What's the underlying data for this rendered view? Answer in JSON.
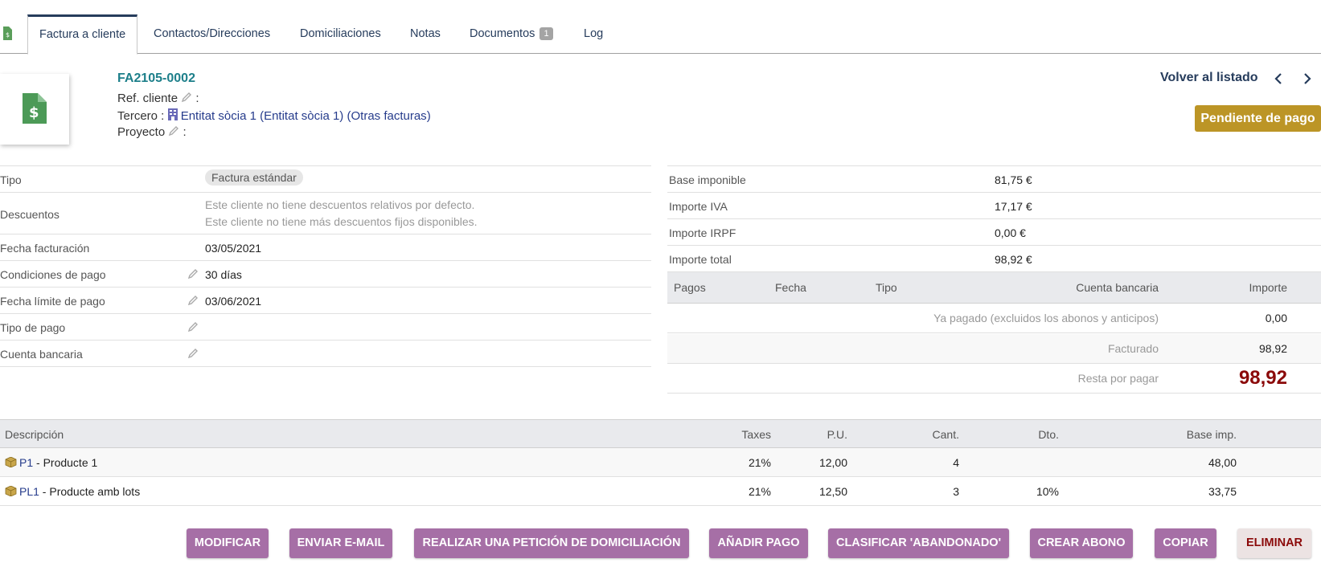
{
  "tabs": [
    {
      "label": "Factura a cliente",
      "active": true
    },
    {
      "label": "Contactos/Direcciones"
    },
    {
      "label": "Domiciliaciones"
    },
    {
      "label": "Notas"
    },
    {
      "label": "Documentos",
      "badge": "1"
    },
    {
      "label": "Log"
    }
  ],
  "header": {
    "ref": "FA2105-0002",
    "ref_cliente_label": "Ref. cliente",
    "tercero_label": "Tercero :",
    "tercero_link": "Entitat sòcia 1 (Entitat sòcia 1)",
    "otras_facturas": "Otras facturas",
    "proyecto_label": "Proyecto",
    "back_label": "Volver al listado",
    "prev_icon": "chevron-left-icon",
    "next_icon": "chevron-right-icon",
    "status": "Pendiente de pago",
    "status_color": "#bc9526"
  },
  "info": {
    "tipo_label": "Tipo",
    "tipo_value": "Factura estándar",
    "descuentos_label": "Descuentos",
    "descuentos_line1": "Este cliente no tiene descuentos relativos por defecto.",
    "descuentos_line2": "Este cliente no tiene más descuentos fijos disponibles.",
    "fecha_fact_label": "Fecha facturación",
    "fecha_fact_value": "03/05/2021",
    "condiciones_label": "Condiciones de pago",
    "condiciones_value": "30 días",
    "fecha_limite_label": "Fecha límite de pago",
    "fecha_limite_value": "03/06/2021",
    "tipo_pago_label": "Tipo de pago",
    "cuenta_label": "Cuenta bancaria"
  },
  "amounts": [
    {
      "label": "Base imponible",
      "value": "81,75 €"
    },
    {
      "label": "Importe IVA",
      "value": "17,17 €"
    },
    {
      "label": "Importe IRPF",
      "value": "0,00 €"
    },
    {
      "label": "Importe total",
      "value": "98,92 €"
    }
  ],
  "payments": {
    "headers": {
      "pagos": "Pagos",
      "fecha": "Fecha",
      "tipo": "Tipo",
      "cuenta": "Cuenta bancaria",
      "importe": "Importe"
    },
    "ya_pagado_label": "Ya pagado (excluidos los abonos y anticipos)",
    "ya_pagado_value": "0,00",
    "facturado_label": "Facturado",
    "facturado_value": "98,92",
    "resta_label": "Resta por pagar",
    "resta_value": "98,92"
  },
  "lines": {
    "headers": {
      "desc": "Descripción",
      "taxes": "Taxes",
      "pu": "P.U.",
      "cant": "Cant.",
      "dto": "Dto.",
      "base": "Base imp."
    },
    "rows": [
      {
        "ref": "P1",
        "desc": " - Producte 1",
        "taxes": "21%",
        "pu": "12,00",
        "cant": "4",
        "dto": "",
        "base": "48,00"
      },
      {
        "ref": "PL1",
        "desc": " - Producte amb lots",
        "taxes": "21%",
        "pu": "12,50",
        "cant": "3",
        "dto": "10%",
        "base": "33,75"
      }
    ]
  },
  "actions": {
    "modificar": "MODIFICAR",
    "email": "ENVIAR E-MAIL",
    "domiciliacion": "REALIZAR UNA PETICIÓN DE DOMICILIACIÓN",
    "pago": "AÑADIR PAGO",
    "abandonado": "CLASIFICAR 'ABANDONADO'",
    "abono": "CREAR ABONO",
    "copiar": "COPIAR",
    "eliminar": "ELIMINAR"
  }
}
